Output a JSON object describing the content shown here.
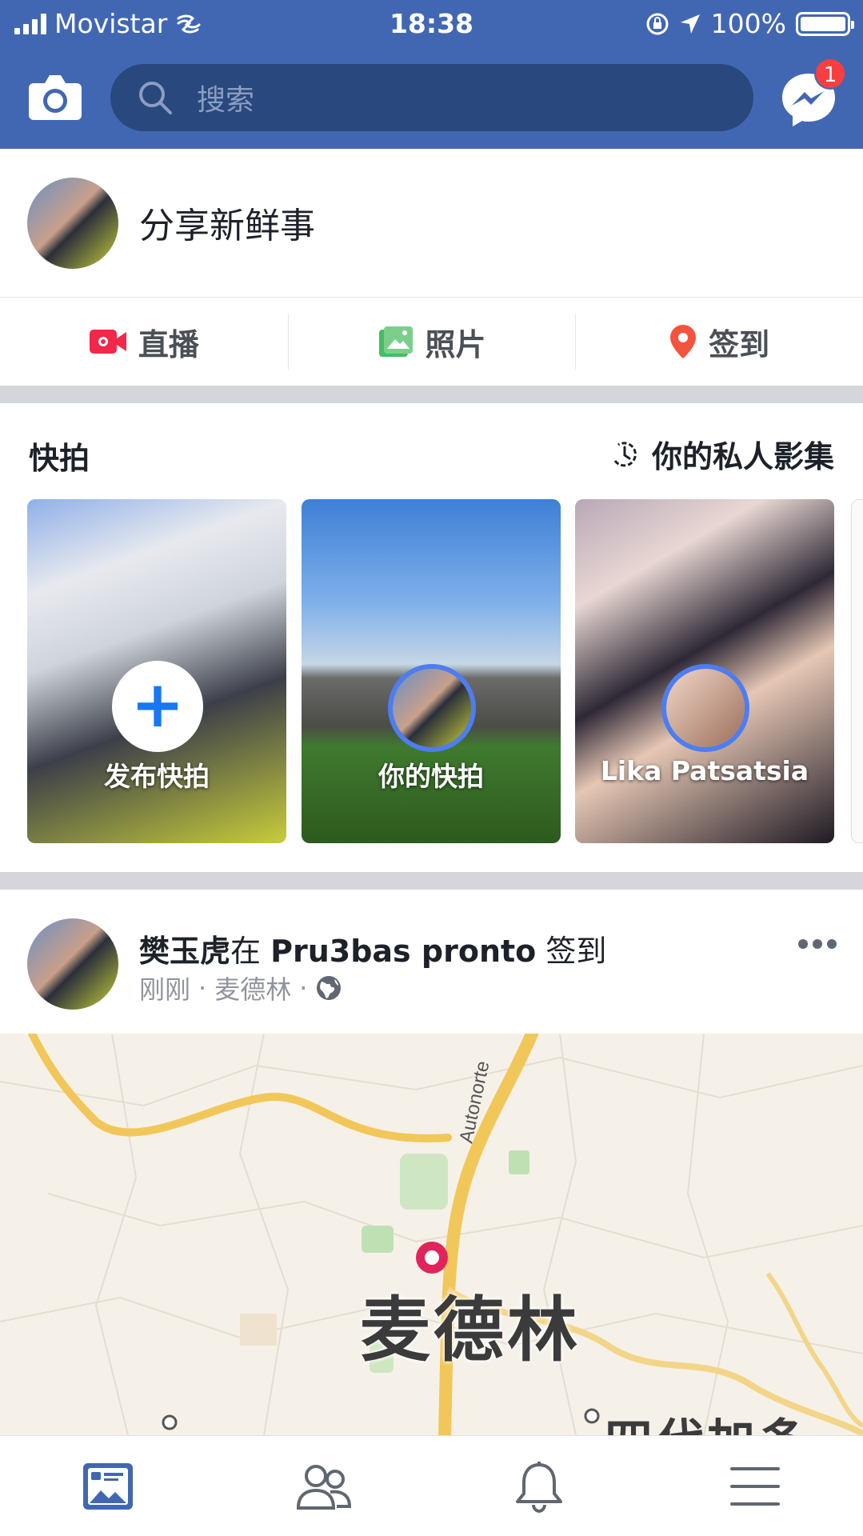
{
  "status_bar": {
    "carrier": "Movistar",
    "time": "18:38",
    "battery": "100%"
  },
  "header": {
    "search_placeholder": "搜索",
    "messenger_badge": "1"
  },
  "composer": {
    "prompt": "分享新鲜事",
    "actions": [
      {
        "label": "直播",
        "icon": "live-video-icon"
      },
      {
        "label": "照片",
        "icon": "photo-icon"
      },
      {
        "label": "签到",
        "icon": "location-pin-icon"
      }
    ]
  },
  "stories": {
    "title": "快拍",
    "archive_label": "你的私人影集",
    "cards": [
      {
        "label": "发布快拍"
      },
      {
        "label": "你的快拍"
      },
      {
        "label": "Lika Patsatsia"
      }
    ]
  },
  "post": {
    "author": "樊玉虎",
    "action_text": "在",
    "place": "Pru3bas pronto",
    "checkin_text": "签到",
    "time": "刚刚",
    "location": "麦德林",
    "separator": "·",
    "map": {
      "road_label": "Autonorte",
      "city_label": "麦德林",
      "cut_label": "四代加多"
    }
  },
  "tabs": [
    {
      "name": "news-feed",
      "icon": "news-feed-icon"
    },
    {
      "name": "friends",
      "icon": "friends-icon"
    },
    {
      "name": "notifications",
      "icon": "bell-icon"
    },
    {
      "name": "menu",
      "icon": "menu-icon"
    }
  ],
  "colors": {
    "brand": "#4267b2",
    "search_bg": "#29487d",
    "badge": "#fa3e3e",
    "story_ring": "#4d7df0",
    "map_pin": "#e0245e"
  }
}
